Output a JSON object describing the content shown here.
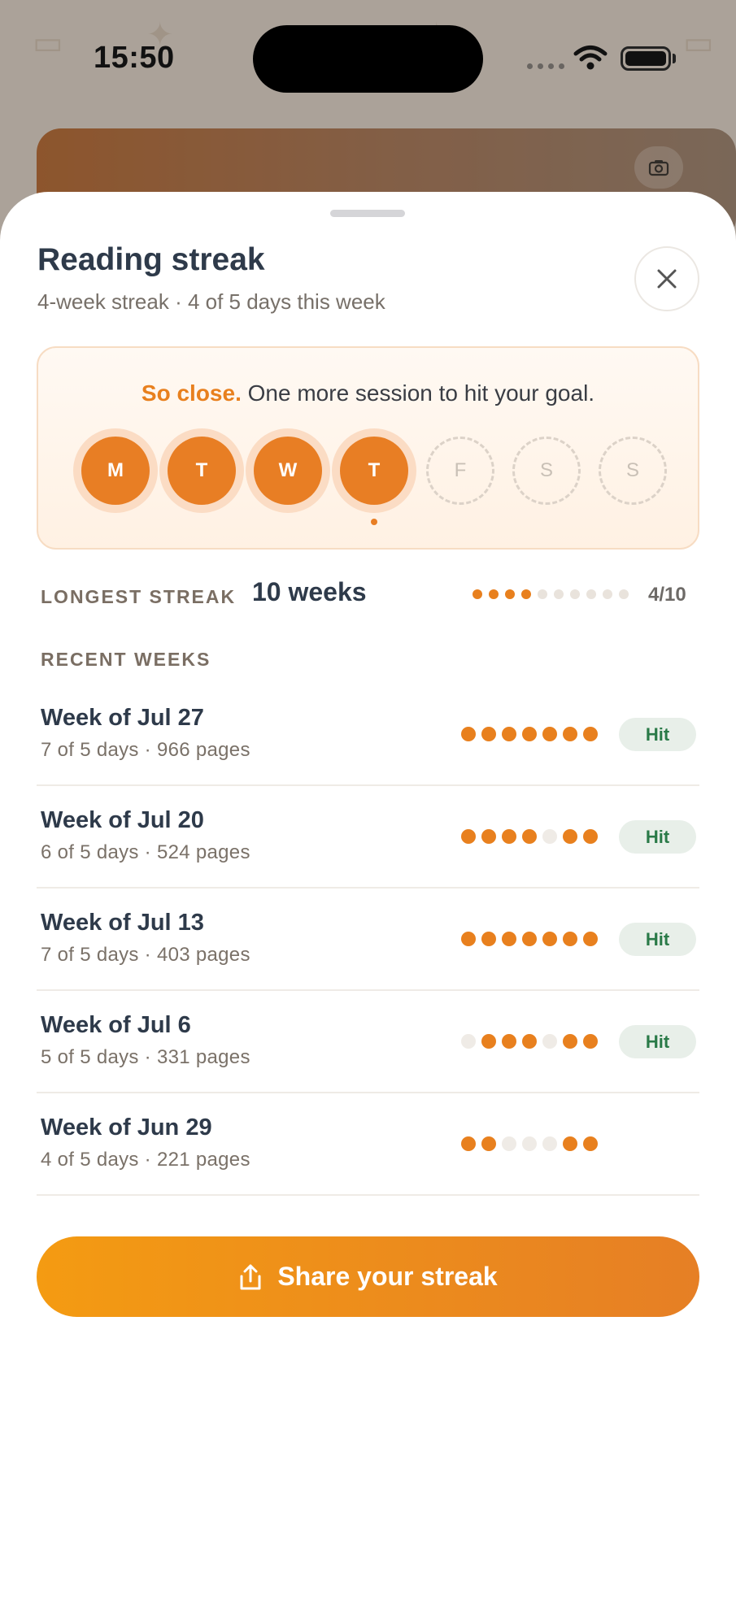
{
  "status_bar": {
    "time": "15:50"
  },
  "sheet": {
    "title": "Reading streak",
    "subtitle": "4-week streak · 4 of 5 days this week"
  },
  "goal": {
    "accent": "So close.",
    "message": " One more session to hit your goal.",
    "days": [
      {
        "label": "M",
        "done": true
      },
      {
        "label": "T",
        "done": true
      },
      {
        "label": "W",
        "done": true
      },
      {
        "label": "T",
        "done": true,
        "today": true
      },
      {
        "label": "F",
        "done": false
      },
      {
        "label": "S",
        "done": false
      },
      {
        "label": "S",
        "done": false
      }
    ]
  },
  "longest": {
    "label": "LONGEST STREAK",
    "value": "10 weeks",
    "progress_current": 4,
    "progress_total": 10,
    "progress_text": "4/10"
  },
  "recent": {
    "label": "RECENT WEEKS",
    "weeks": [
      {
        "title": "Week of Jul 27",
        "sub": "7 of 5 days · 966 pages",
        "days": [
          1,
          1,
          1,
          1,
          1,
          1,
          1
        ],
        "badge": "Hit"
      },
      {
        "title": "Week of Jul 20",
        "sub": "6 of 5 days · 524 pages",
        "days": [
          1,
          1,
          1,
          1,
          0,
          1,
          1
        ],
        "badge": "Hit"
      },
      {
        "title": "Week of Jul 13",
        "sub": "7 of 5 days · 403 pages",
        "days": [
          1,
          1,
          1,
          1,
          1,
          1,
          1
        ],
        "badge": "Hit"
      },
      {
        "title": "Week of Jul 6",
        "sub": "5 of 5 days · 331 pages",
        "days": [
          0,
          1,
          1,
          1,
          0,
          1,
          1
        ],
        "badge": "Hit"
      },
      {
        "title": "Week of Jun 29",
        "sub": "4 of 5 days · 221 pages",
        "days": [
          1,
          1,
          0,
          0,
          0,
          1,
          1
        ],
        "badge": ""
      }
    ]
  },
  "share_button": {
    "label": "Share your streak",
    "icon": "share-icon"
  },
  "colors": {
    "accent": "#e8801e",
    "inactive": "#efebe6",
    "hit_text": "#2a7a48",
    "hit_bg": "#e8efe9"
  }
}
